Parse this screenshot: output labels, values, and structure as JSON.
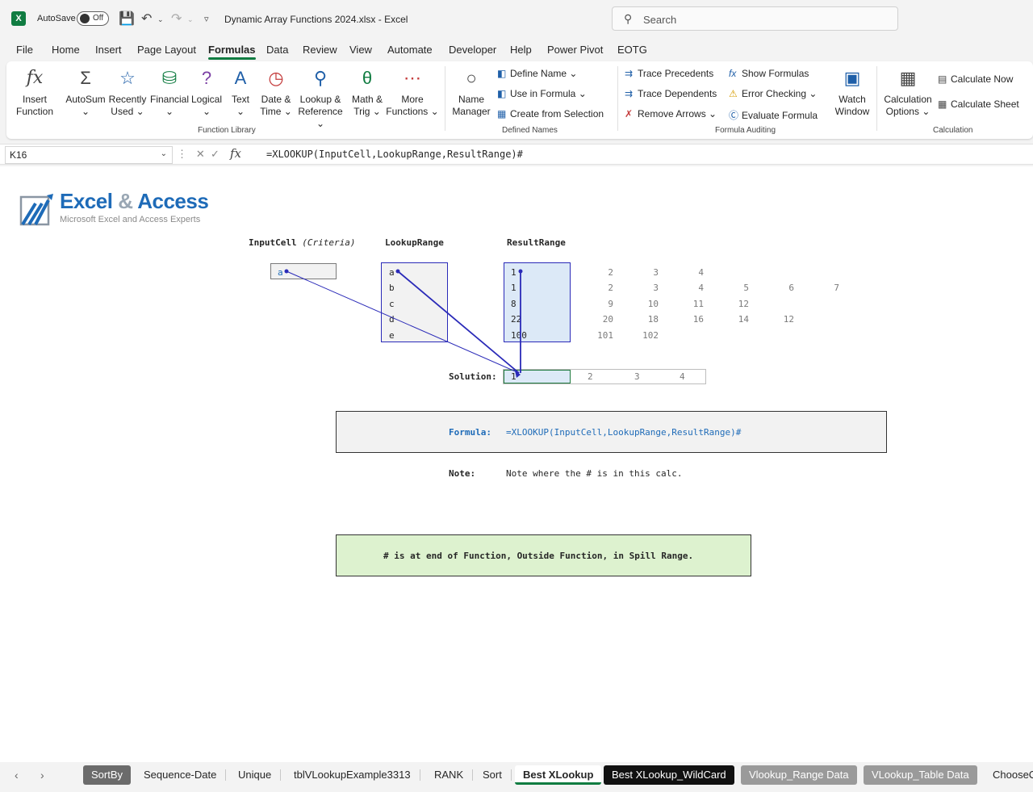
{
  "titlebar": {
    "autosave_label": "AutoSave",
    "autosave_state": "Off",
    "file_title": "Dynamic Array Functions 2024.xlsx  -  Excel",
    "search_placeholder": "Search"
  },
  "menu": [
    "File",
    "Home",
    "Insert",
    "Page Layout",
    "Formulas",
    "Data",
    "Review",
    "View",
    "Automate",
    "Developer",
    "Help",
    "Power Pivot",
    "EOTG"
  ],
  "menu_active": "Formulas",
  "ribbon": {
    "function_library": {
      "label": "Function Library",
      "buttons": [
        {
          "line1": "Insert",
          "line2": "Function",
          "icon": "fx-icon"
        },
        {
          "line1": "AutoSum",
          "line2": "⌄",
          "icon": "sigma-icon"
        },
        {
          "line1": "Recently",
          "line2": "Used ⌄",
          "icon": "star-book-icon"
        },
        {
          "line1": "Financial",
          "line2": "⌄",
          "icon": "database-icon"
        },
        {
          "line1": "Logical",
          "line2": "⌄",
          "icon": "question-book-icon"
        },
        {
          "line1": "Text",
          "line2": "⌄",
          "icon": "text-a-icon"
        },
        {
          "line1": "Date &",
          "line2": "Time ⌄",
          "icon": "clock-icon"
        },
        {
          "line1": "Lookup &",
          "line2": "Reference ⌄",
          "icon": "magnifier-book-icon"
        },
        {
          "line1": "Math &",
          "line2": "Trig ⌄",
          "icon": "theta-book-icon"
        },
        {
          "line1": "More",
          "line2": "Functions ⌄",
          "icon": "more-book-icon"
        }
      ]
    },
    "defined_names": {
      "label": "Defined Names",
      "name_manager": {
        "line1": "Name",
        "line2": "Manager"
      },
      "items": [
        "Define Name  ⌄",
        "Use in Formula ⌄",
        "Create from Selection"
      ]
    },
    "formula_auditing": {
      "label": "Formula Auditing",
      "items": [
        "Trace Precedents",
        "Trace Dependents",
        "Remove Arrows  ⌄",
        "Show Formulas",
        "Error Checking  ⌄",
        "Evaluate Formula"
      ],
      "watch": {
        "line1": "Watch",
        "line2": "Window"
      }
    },
    "calculation": {
      "label": "Calculation",
      "options": {
        "line1": "Calculation",
        "line2": "Options ⌄"
      },
      "items": [
        "Calculate Now",
        "Calculate Sheet"
      ]
    }
  },
  "formula_bar": {
    "name_box": "K16",
    "formula": "=XLOOKUP(InputCell,LookupRange,ResultRange)#"
  },
  "logo": {
    "title_a": "Excel",
    "title_amp": "&",
    "title_b": "Access",
    "subtitle": "Microsoft Excel and Access Experts"
  },
  "sheet": {
    "headers": {
      "input": "InputCell",
      "criteria": "(Criteria)",
      "lookup": "LookupRange",
      "result": "ResultRange"
    },
    "input_value": "a",
    "lookup_values": [
      "a",
      "b",
      "c",
      "d",
      "e"
    ],
    "result_col1": [
      "1",
      "1",
      "8",
      "22",
      "100"
    ],
    "spill_rows": [
      [
        "2",
        "3",
        "4",
        "",
        "",
        ""
      ],
      [
        "2",
        "3",
        "4",
        "5",
        "6",
        "7"
      ],
      [
        "9",
        "10",
        "11",
        "12",
        "",
        ""
      ],
      [
        "20",
        "18",
        "16",
        "14",
        "12",
        ""
      ],
      [
        "101",
        "102",
        "",
        "",
        "",
        ""
      ]
    ],
    "solution_label": "Solution:",
    "solution_values": [
      "1",
      "2",
      "3",
      "4"
    ],
    "formula_label": "Formula:",
    "formula_text": "=XLOOKUP(InputCell,LookupRange,ResultRange)#",
    "note_label": "Note:",
    "note_text": "Note where the # is in this calc.",
    "green_text": "# is at end of Function, Outside Function, in Spill Range."
  },
  "colors": {
    "excel_green": "#107c41",
    "arrow_blue": "#2a2ab8",
    "formula_blue": "#1e6bb8",
    "highlight": "#dce9f7",
    "green_box": "#ddf2cf"
  },
  "tabs": [
    {
      "label": "SortBy",
      "style": "dark"
    },
    {
      "label": "Sequence-Date",
      "style": "plain"
    },
    {
      "label": "Unique",
      "style": "plain"
    },
    {
      "label": "tblVLookupExample3313",
      "style": "plain"
    },
    {
      "label": "RANK",
      "style": "plain"
    },
    {
      "label": "Sort",
      "style": "plain"
    },
    {
      "label": "Best XLookup",
      "style": "sel"
    },
    {
      "label": "Best XLookup_WildCard",
      "style": "black"
    },
    {
      "label": "Vlookup_Range Data",
      "style": "grey"
    },
    {
      "label": "VLookup_Table Data",
      "style": "grey"
    },
    {
      "label": "ChooseCols",
      "style": "plain"
    }
  ]
}
